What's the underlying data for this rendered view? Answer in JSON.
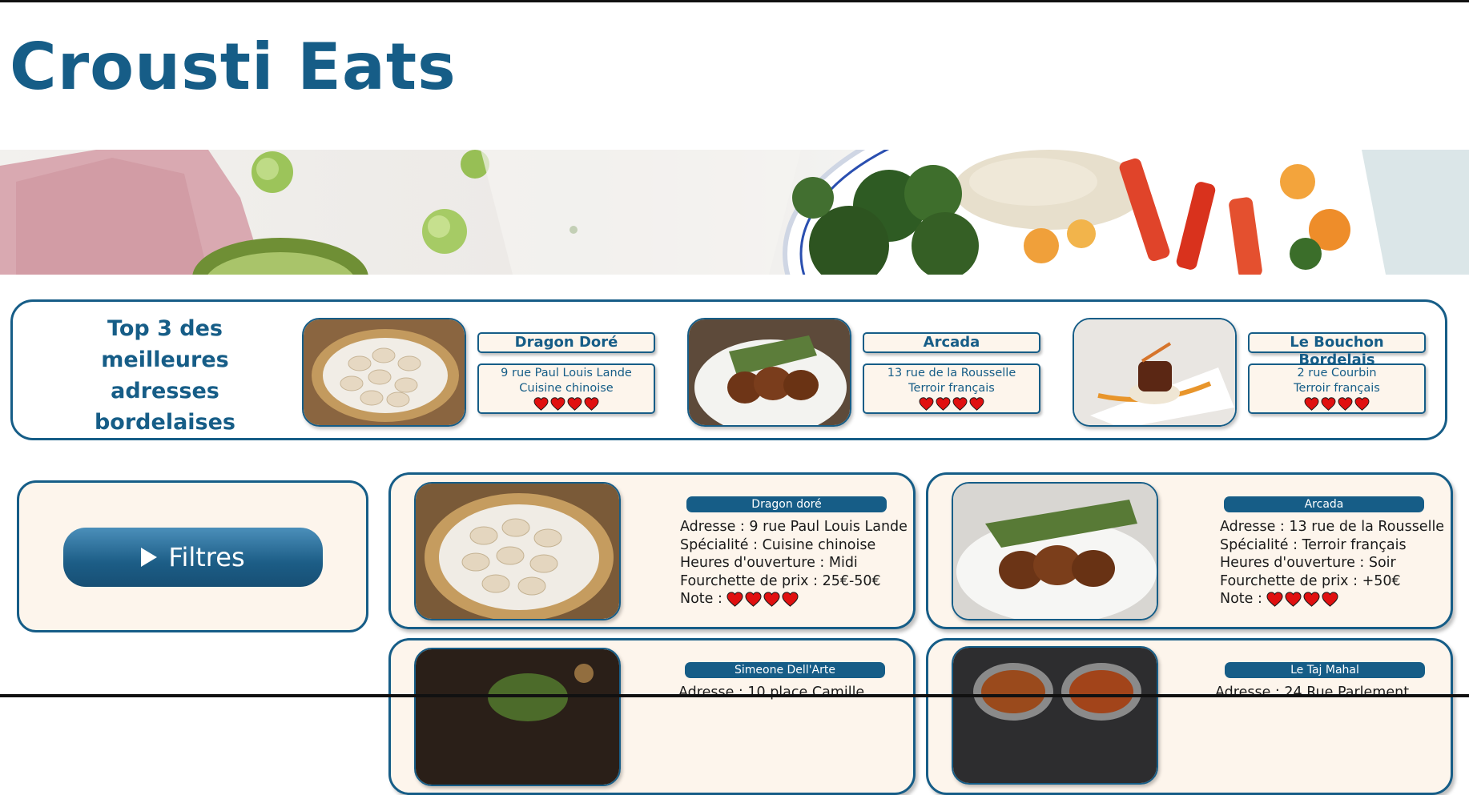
{
  "site": {
    "title": "Crousti Eats"
  },
  "colors": {
    "primary": "#165d87",
    "card_bg": "#fdf5ec",
    "heart": "#e01010"
  },
  "top3": {
    "title_line1": "Top 3 des",
    "title_line2": "meilleures",
    "title_line3": "adresses",
    "title_line4": "bordelaises",
    "items": [
      {
        "name": "Dragon Doré",
        "address": "9 rue Paul Louis Lande",
        "cuisine": "Cuisine chinoise",
        "rating": 4,
        "photo": "dumplings"
      },
      {
        "name": "Arcada",
        "address": "13 rue de la Rousselle",
        "cuisine": "Terroir français",
        "rating": 4,
        "photo": "roast-duck"
      },
      {
        "name": "Le Bouchon Bordelais",
        "address": "2 rue Courbin",
        "cuisine": "Terroir français",
        "rating": 4,
        "photo": "steak-puree"
      }
    ]
  },
  "filters": {
    "label": "Filtres",
    "icon": "play-triangle-icon"
  },
  "restaurants": [
    {
      "name": "Dragon doré",
      "address": "Adresse : 9 rue Paul Louis Lande",
      "specialty": "Spécialité : Cuisine chinoise",
      "hours": "Heures d'ouverture : Midi",
      "price": "Fourchette de prix : 25€-50€",
      "note_label": "Note :",
      "rating": 4,
      "photo": "dumplings"
    },
    {
      "name": "Arcada",
      "address": "Adresse : 13 rue de la Rousselle",
      "specialty": "Spécialité : Terroir français",
      "hours": "Heures d'ouverture : Soir",
      "price": "Fourchette de prix : +50€",
      "note_label": "Note :",
      "rating": 4,
      "photo": "roast-duck"
    },
    {
      "name": "Simeone Dell'Arte",
      "address": "Adresse : 10 place Camille",
      "photo": "pasta-dark"
    },
    {
      "name": "Le Taj Mahal",
      "address": "Adresse : 24 Rue Parlement",
      "photo": "curry-bowls"
    }
  ]
}
